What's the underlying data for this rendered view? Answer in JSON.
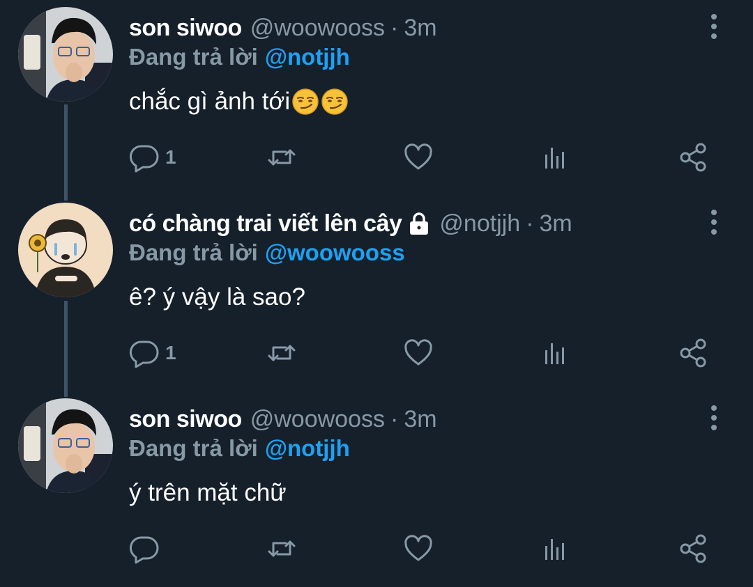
{
  "tweets": [
    {
      "display_name": "son siwoo",
      "handle": "@woowooss",
      "separator": "·",
      "time": "3m",
      "reply_prefix": "Đang trả lời",
      "reply_to": "@notjjh",
      "text": "chắc gì ảnh tới",
      "emojis": [
        "smirking-face-emoji",
        "smirking-face-emoji"
      ],
      "reply_count": "1",
      "locked": false
    },
    {
      "display_name": "có chàng trai viết lên cây",
      "handle": "@notjjh",
      "separator": "·",
      "time": "3m",
      "reply_prefix": "Đang trả lời",
      "reply_to": "@woowooss",
      "text": "ê? ý vậy là sao?",
      "emojis": [],
      "reply_count": "1",
      "locked": true
    },
    {
      "display_name": "son siwoo",
      "handle": "@woowooss",
      "separator": "·",
      "time": "3m",
      "reply_prefix": "Đang trả lời",
      "reply_to": "@notjjh",
      "text": "ý trên mặt chữ",
      "emojis": [],
      "reply_count": "",
      "locked": false
    }
  ],
  "icons": {
    "reply": "comment-icon",
    "retweet": "retweet-icon",
    "like": "heart-icon",
    "stats": "analytics-icon",
    "share": "share-icon",
    "more": "more-vertical-icon",
    "lock": "lock-icon"
  },
  "colors": {
    "background": "#15202b",
    "text": "#ffffff",
    "secondary": "#8899a6",
    "accent": "#1da1f2",
    "thread_line": "#3d5466"
  }
}
